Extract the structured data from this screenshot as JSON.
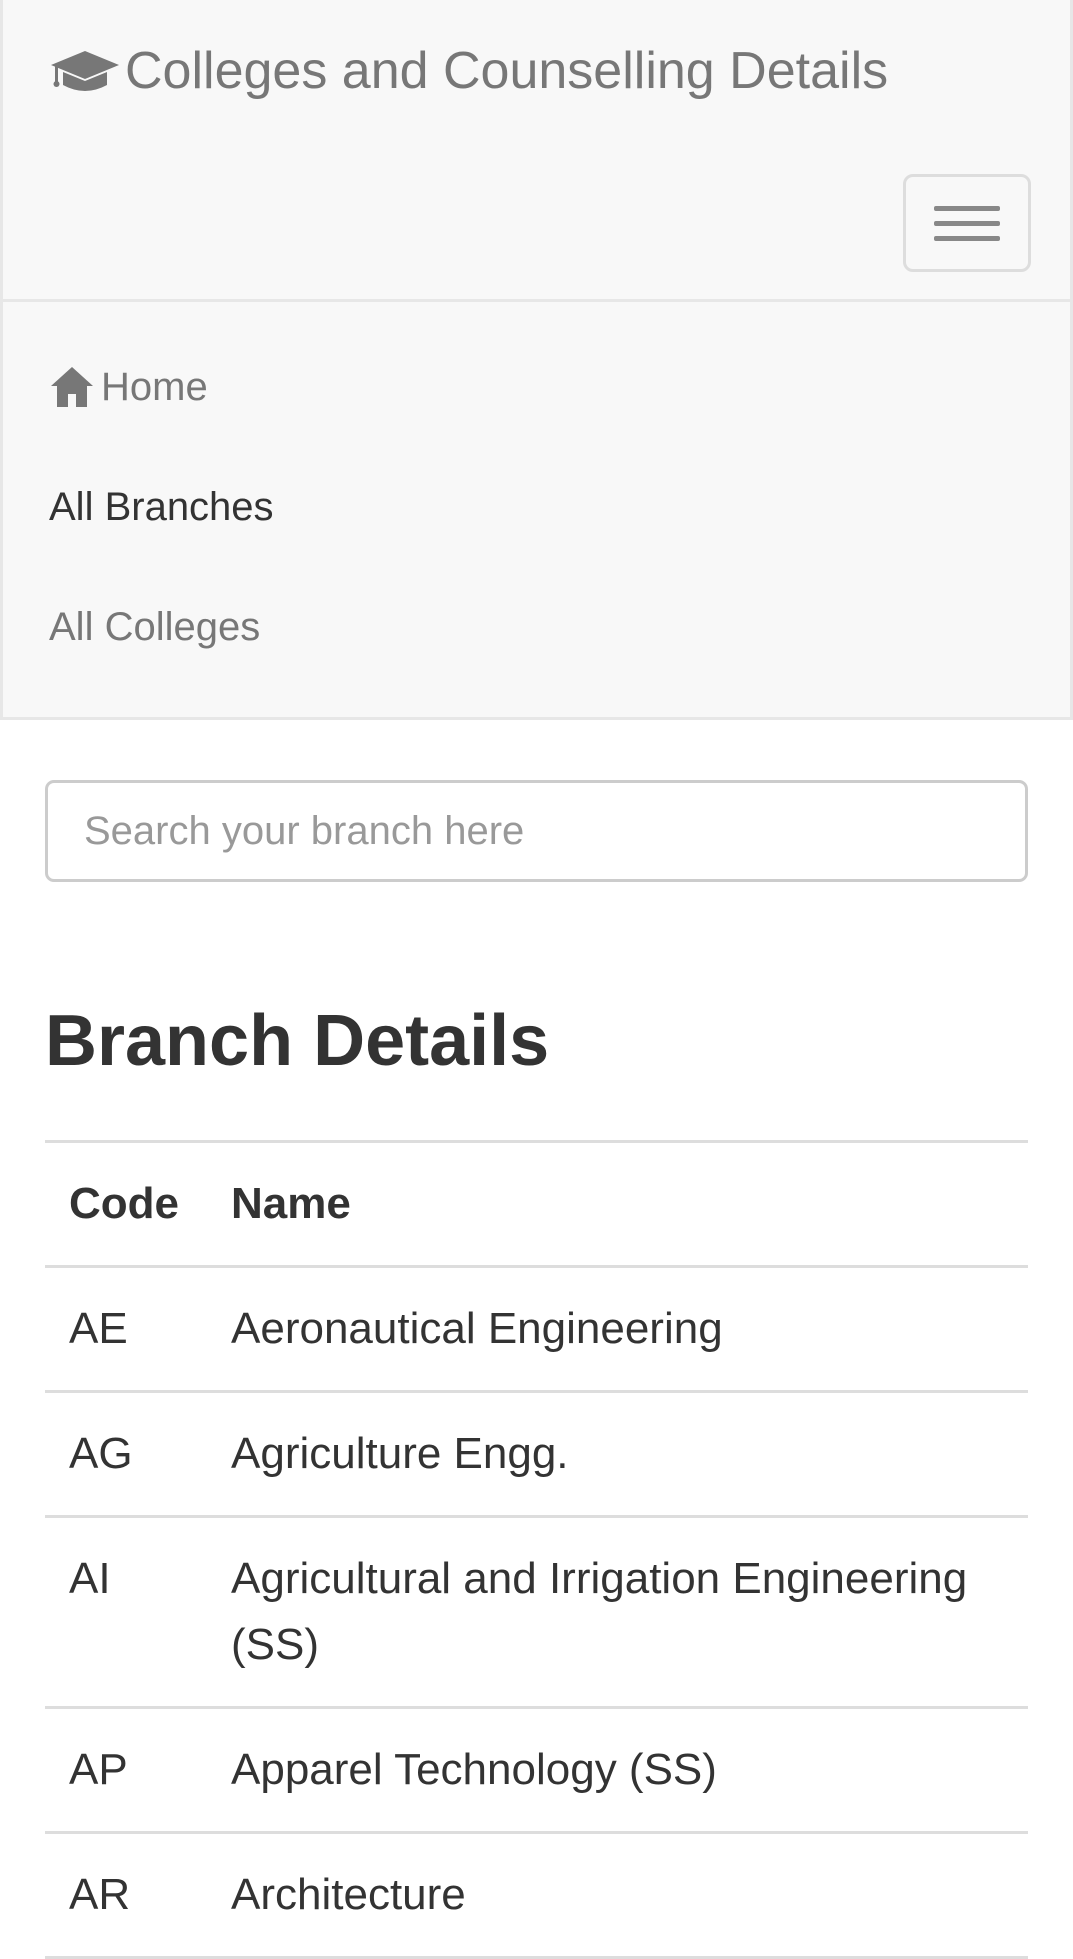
{
  "navbar": {
    "brand": "Colleges and Counselling Details",
    "menu": [
      {
        "label": "Home",
        "icon": "home-icon"
      },
      {
        "label": "All Branches",
        "active": true
      },
      {
        "label": "All Colleges"
      }
    ]
  },
  "search": {
    "placeholder": "Search your branch here",
    "value": ""
  },
  "page": {
    "heading": "Branch Details"
  },
  "table": {
    "headers": [
      "Code",
      "Name"
    ],
    "rows": [
      {
        "code": "AE",
        "name": "Aeronautical Engineering"
      },
      {
        "code": "AG",
        "name": "Agriculture Engg."
      },
      {
        "code": "AI",
        "name": "Agricultural and Irrigation Engineering (SS)"
      },
      {
        "code": "AP",
        "name": "Apparel Technology (SS)"
      },
      {
        "code": "AR",
        "name": "Architecture"
      }
    ]
  },
  "colors": {
    "navbar_bg": "#f8f8f8",
    "nav_link": "#777777",
    "active_link": "#333333",
    "border": "#dddddd"
  }
}
